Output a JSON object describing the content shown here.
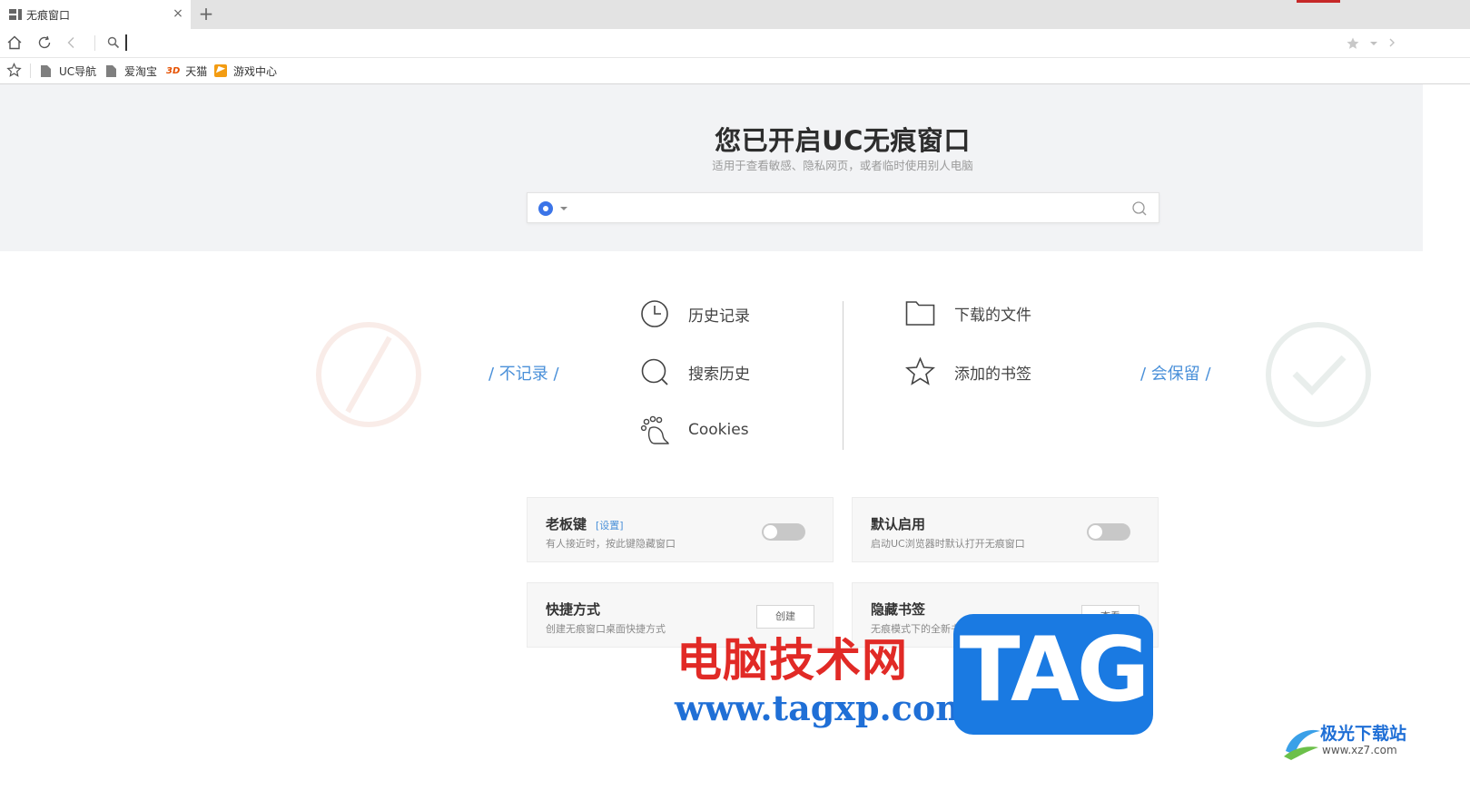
{
  "tab": {
    "title": "无痕窗口",
    "close": "×",
    "new_tab": "+"
  },
  "toolbar": {
    "address_value": "",
    "address_placeholder": ""
  },
  "bookmarks": [
    {
      "label": "UC导航",
      "icon": "doc-icon"
    },
    {
      "label": "爱淘宝",
      "icon": "doc-icon"
    },
    {
      "label": "天猫",
      "icon": "tmall-icon",
      "icon_text": "3D"
    },
    {
      "label": "游戏中心",
      "icon": "game-center-icon"
    }
  ],
  "hero": {
    "title": "您已开启UC无痕窗口",
    "subtitle": "适用于查看敏感、隐私网页，或者临时使用别人电脑",
    "search_placeholder": ""
  },
  "features": {
    "not_recorded_label": "/ 不记录 /",
    "kept_label": "/ 会保留 /",
    "not_recorded": [
      "历史记录",
      "搜索历史",
      "Cookies"
    ],
    "kept": [
      "下载的文件",
      "添加的书签"
    ]
  },
  "cards": {
    "boss_key": {
      "title": "老板键",
      "link": "[设置]",
      "desc": "有人接近时，按此键隐藏窗口",
      "enabled": false
    },
    "default_on": {
      "title": "默认启用",
      "desc": "启动UC浏览器时默认打开无痕窗口",
      "enabled": false
    },
    "shortcut": {
      "title": "快捷方式",
      "desc": "创建无痕窗口桌面快捷方式",
      "button": "创建"
    },
    "hidden_bookmarks": {
      "title": "隐藏书签",
      "desc": "无痕模式下的全新书签体验",
      "button": "查看"
    }
  },
  "watermarks": {
    "site_cn": "电脑技术网",
    "site_url": "www.tagxp.com",
    "tag": "TAG",
    "jg_name": "极光下载站",
    "jg_url": "www.xz7.com"
  },
  "colors": {
    "accent": "#4a90d9",
    "hero_bg": "#f2f3f5",
    "tag_blue": "#1a7ae2",
    "watermark_red": "#e12a26"
  }
}
